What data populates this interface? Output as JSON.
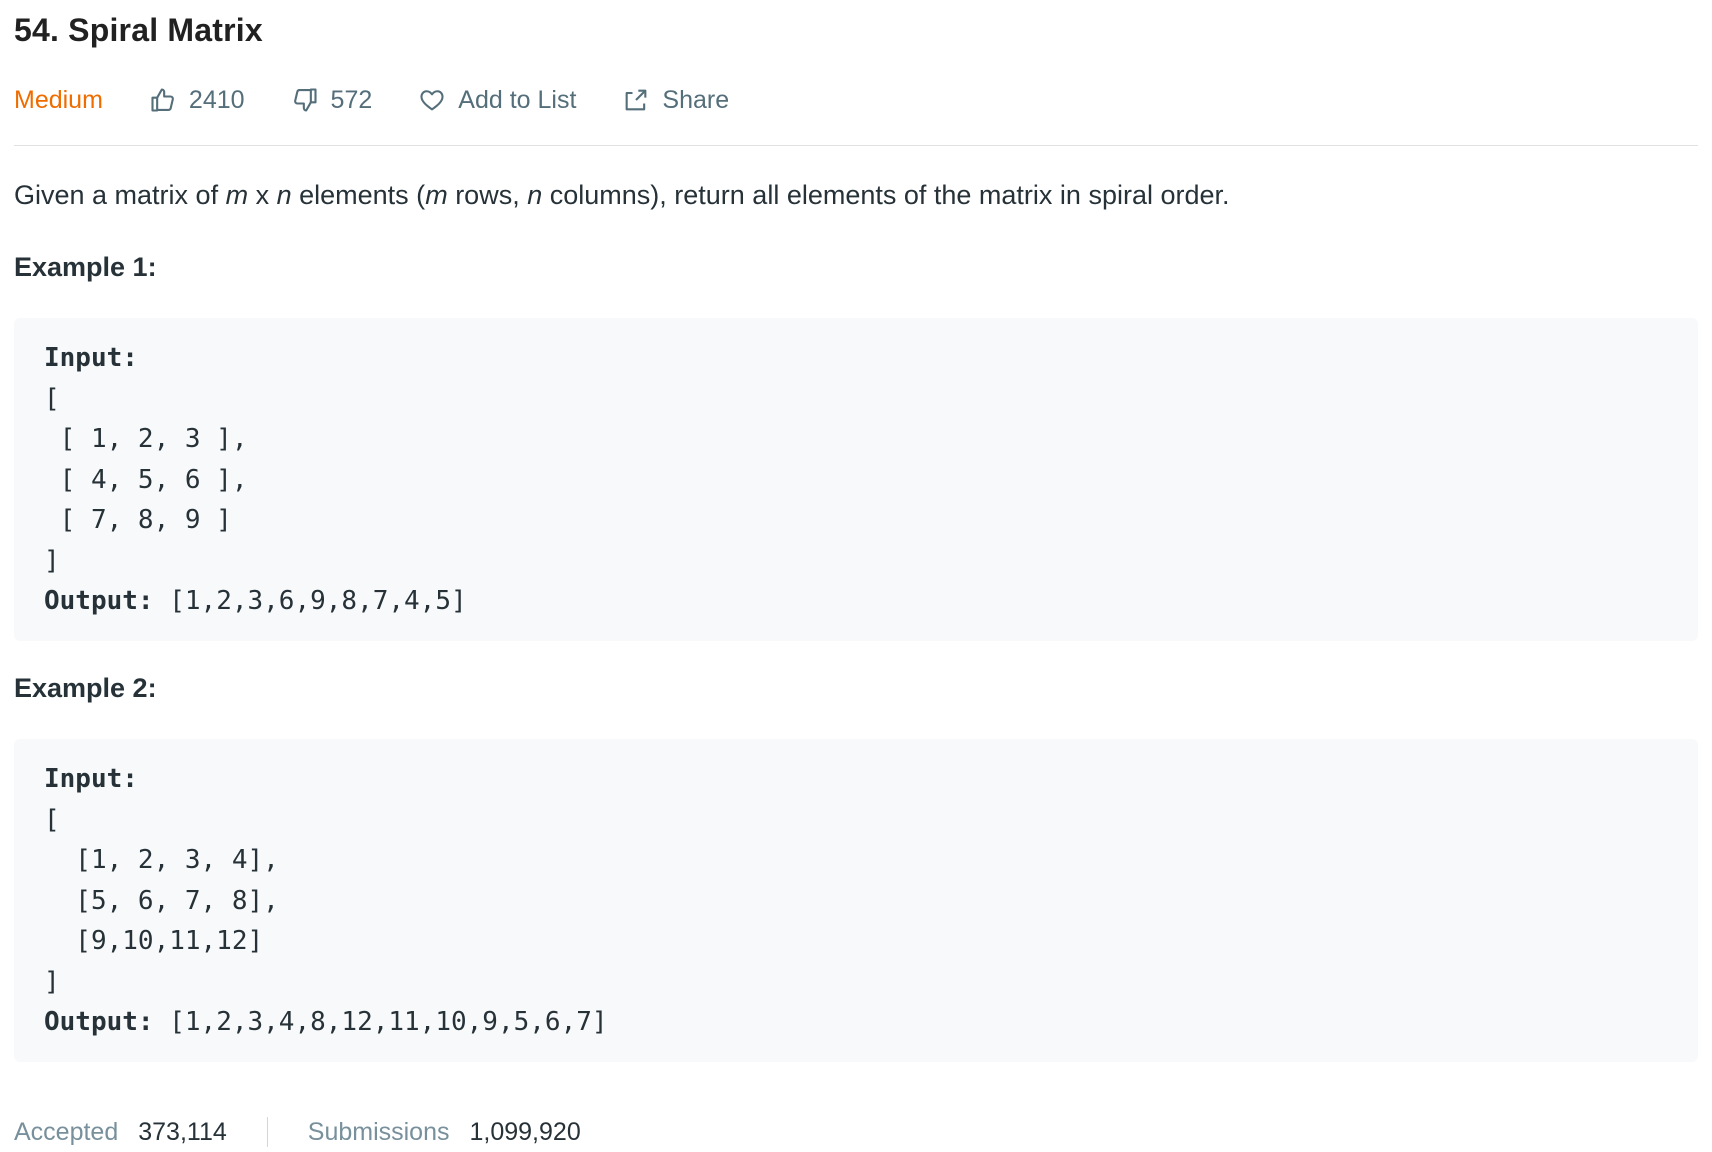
{
  "problem": {
    "title": "54. Spiral Matrix",
    "difficulty": "Medium",
    "likes": "2410",
    "dislikes": "572",
    "add_to_list_label": "Add to List",
    "share_label": "Share",
    "description": {
      "pre": "Given a matrix of ",
      "m1": "m",
      "x": " x ",
      "n1": "n",
      "mid1": " elements (",
      "m2": "m",
      "mid2": " rows, ",
      "n2": "n",
      "post": " columns), return all elements of the matrix in spiral order."
    }
  },
  "examples": [
    {
      "heading": "Example 1:",
      "input_label": "Input:",
      "input_lines": [
        "[",
        " [ 1, 2, 3 ],",
        " [ 4, 5, 6 ],",
        " [ 7, 8, 9 ]",
        "]"
      ],
      "output_label": "Output:",
      "output_value": " [1,2,3,6,9,8,7,4,5]"
    },
    {
      "heading": "Example 2:",
      "input_label": "Input:",
      "input_lines": [
        "[",
        "  [1, 2, 3, 4],",
        "  [5, 6, 7, 8],",
        "  [9,10,11,12]",
        "]"
      ],
      "output_label": "Output:",
      "output_value": " [1,2,3,4,8,12,11,10,9,5,6,7]"
    }
  ],
  "stats": {
    "accepted_label": "Accepted",
    "accepted_value": "373,114",
    "submissions_label": "Submissions",
    "submissions_value": "1,099,920"
  },
  "colors": {
    "difficulty_medium": "#ef6c00",
    "text": "#263238",
    "muted": "#546e7a",
    "code_bg": "#f7f9fa"
  }
}
